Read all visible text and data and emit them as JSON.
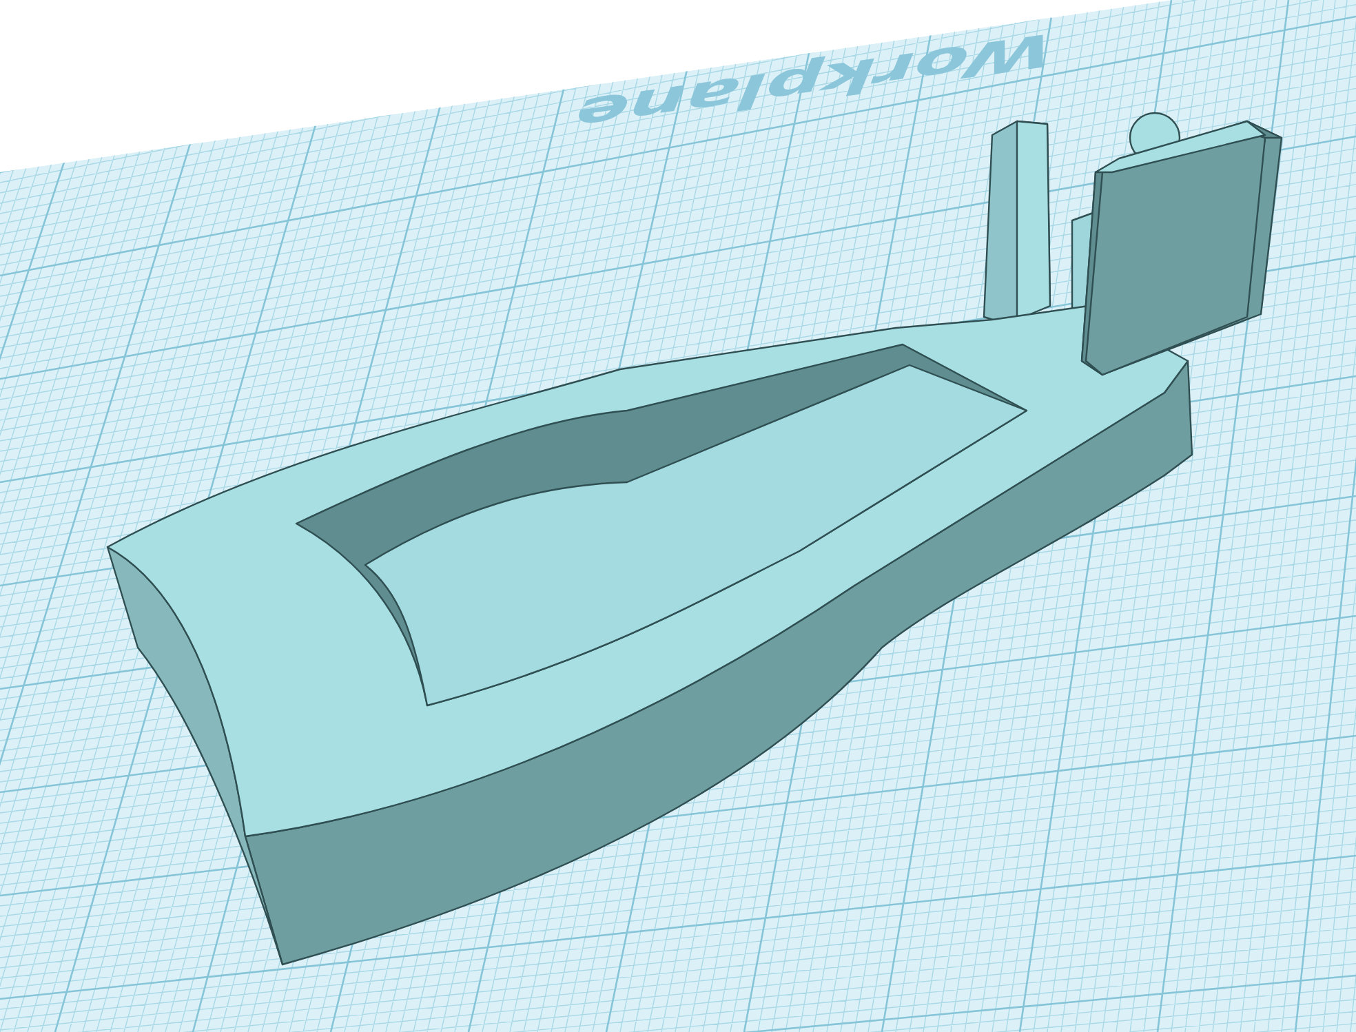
{
  "viewport": {
    "workplane_label": "Workplane"
  }
}
